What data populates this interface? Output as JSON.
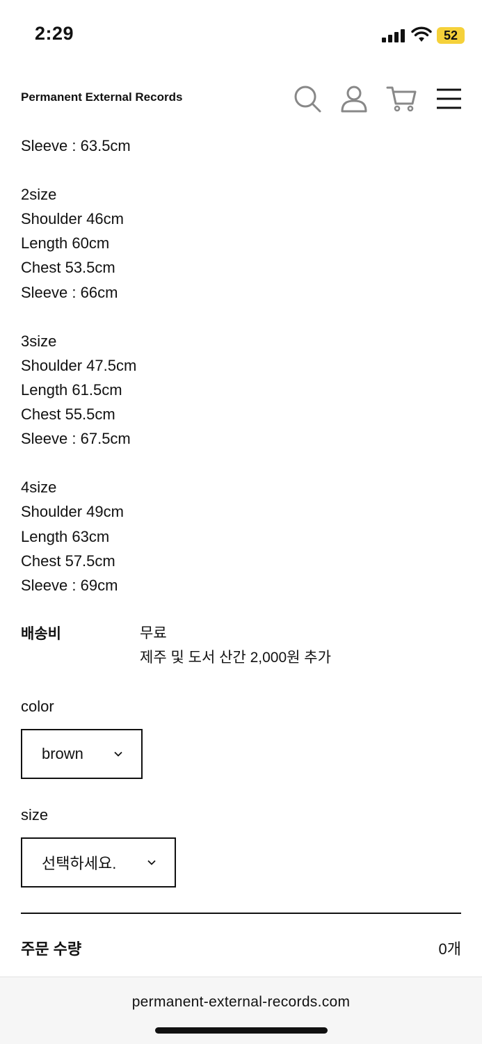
{
  "status_bar": {
    "time": "2:29",
    "battery": "52"
  },
  "header": {
    "brand": "Permanent External Records",
    "icons": [
      "search-icon",
      "account-icon",
      "cart-icon",
      "menu-icon"
    ]
  },
  "specs": [
    {
      "lines": [
        "Sleeve : 63.5cm"
      ]
    },
    {
      "lines": [
        "2size",
        "Shoulder 46cm",
        "Length 60cm",
        "Chest 53.5cm",
        "Sleeve : 66cm"
      ]
    },
    {
      "lines": [
        "3size",
        "Shoulder 47.5cm",
        "Length 61.5cm",
        "Chest 55.5cm",
        "Sleeve : 67.5cm"
      ]
    },
    {
      "lines": [
        "4size",
        "Shoulder 49cm",
        "Length 63cm",
        "Chest 57.5cm",
        "Sleeve : 69cm"
      ]
    }
  ],
  "shipping": {
    "label": "배송비",
    "value": "무료",
    "note": "제주 및 도서 산간 2,000원 추가"
  },
  "options": {
    "color": {
      "label": "color",
      "selected": "brown"
    },
    "size": {
      "label": "size",
      "selected": "선택하세요."
    }
  },
  "order": {
    "label": "주문 수량",
    "value": "0개"
  },
  "browser": {
    "url": "permanent-external-records.com"
  }
}
